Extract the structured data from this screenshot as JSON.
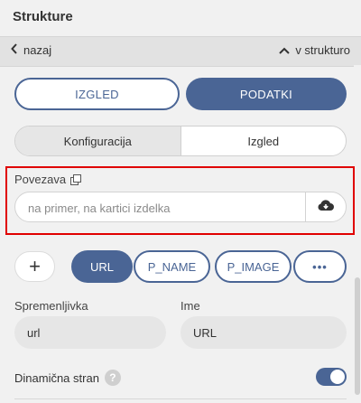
{
  "panel": {
    "title": "Strukture"
  },
  "nav": {
    "back_label": "nazaj",
    "structure_label": "v strukturo"
  },
  "top_tabs": {
    "izgled": "IZGLED",
    "podatki": "PODATKI",
    "active": "PODATKI"
  },
  "sub_tabs": {
    "konfiguracija": "Konfiguracija",
    "izgled": "Izgled",
    "active": "Konfiguracija"
  },
  "link_field": {
    "label": "Povezava",
    "placeholder": "na primer, na kartici izdelka",
    "value": ""
  },
  "chips": {
    "add": "+",
    "items": [
      "URL",
      "P_NAME",
      "P_IMAGE"
    ],
    "more": "•••",
    "active": "URL"
  },
  "variable": {
    "label_spremenljivka": "Spremenljivka",
    "value_spremenljivka": "url",
    "label_ime": "Ime",
    "value_ime": "URL"
  },
  "dynamic_page": {
    "label": "Dinamična stran",
    "help": "?",
    "enabled": true
  },
  "colors": {
    "accent": "#4a6595",
    "highlight": "#e00000"
  },
  "icons": {
    "back": "chevron-left-icon",
    "up": "chevron-up-icon",
    "copy": "copy-icon",
    "cloud": "cloud-download-icon",
    "help": "question-icon"
  }
}
